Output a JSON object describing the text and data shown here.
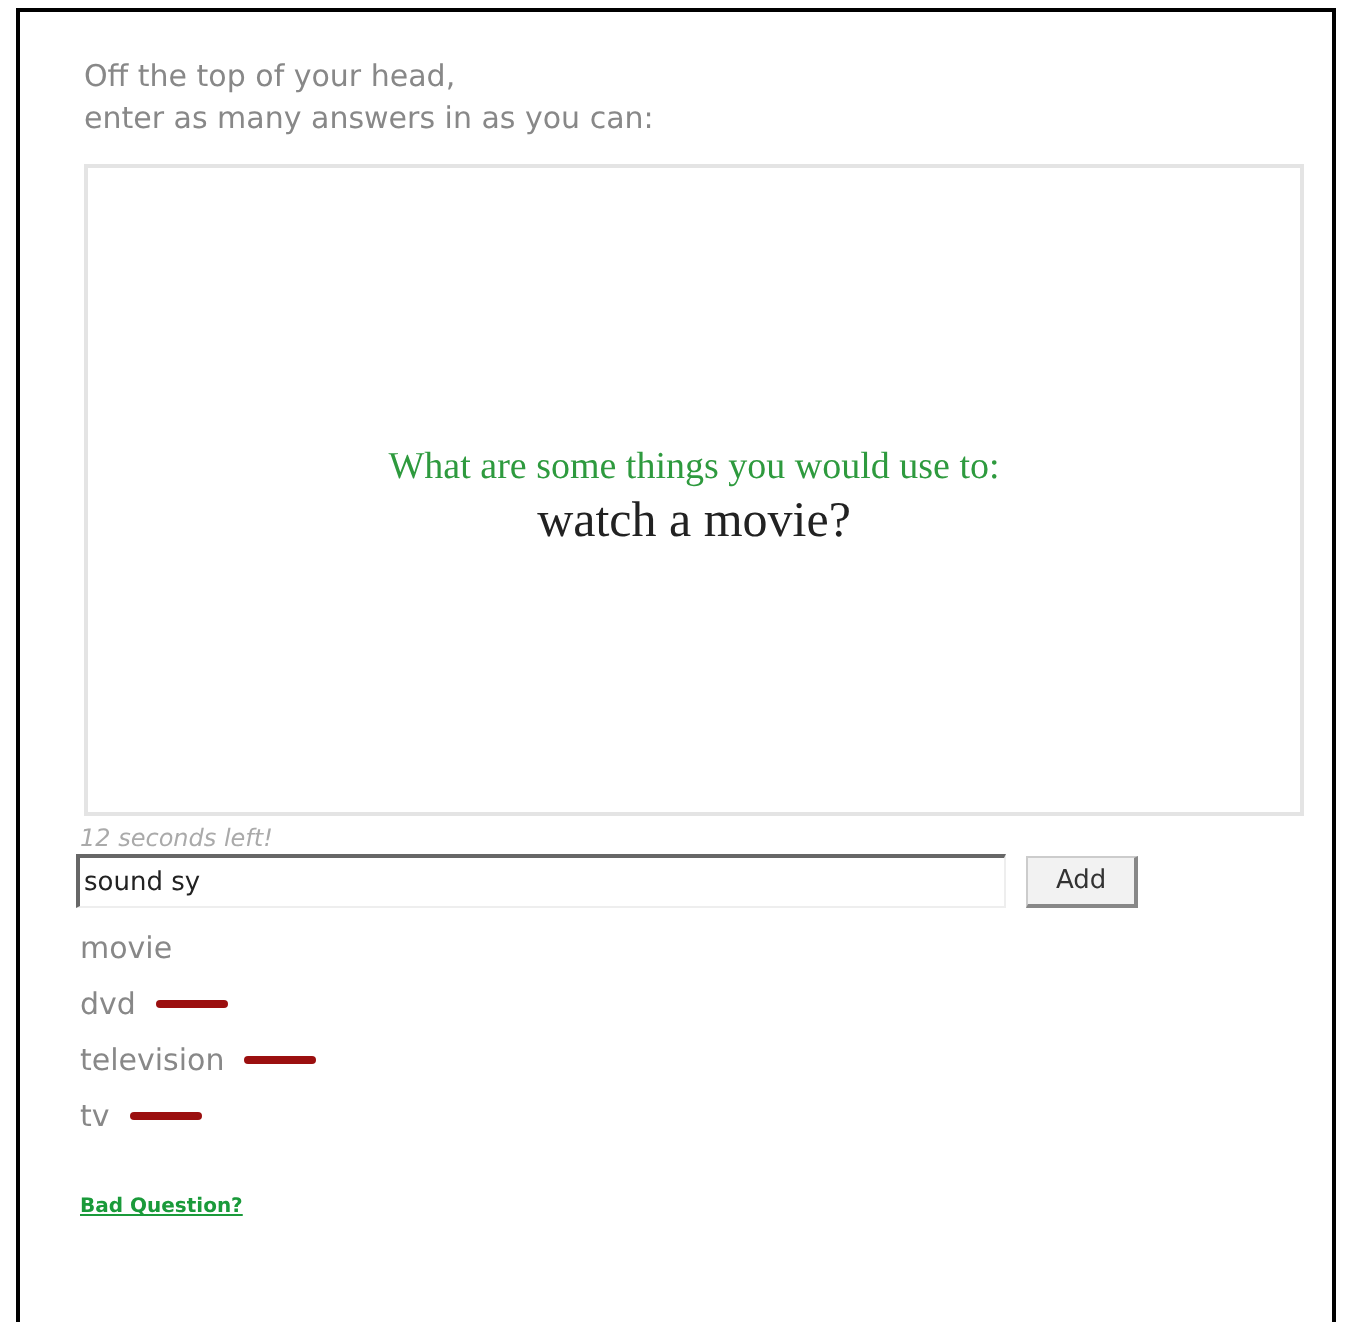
{
  "instructions": [
    "Off the top of your head,",
    "enter as many answers in as you can:"
  ],
  "question": {
    "prompt": "What are some things you would use to:",
    "subject": "watch a movie?"
  },
  "timer": "12 seconds left!",
  "answer_field": {
    "value": "sound sy"
  },
  "add_button": "Add",
  "answers": [
    {
      "text": "movie",
      "marked": false
    },
    {
      "text": "dvd",
      "marked": true
    },
    {
      "text": "television",
      "marked": true
    },
    {
      "text": "tv",
      "marked": true
    }
  ],
  "report_link": "Bad Question?"
}
